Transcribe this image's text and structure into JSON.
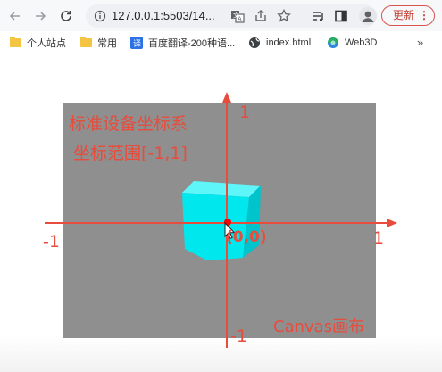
{
  "browser": {
    "url": "127.0.0.1:5503/14...",
    "update_label": "更新",
    "update_menu": "⋮",
    "bookmarks": [
      {
        "label": "个人站点",
        "icon": "folder-icon"
      },
      {
        "label": "常用",
        "icon": "folder-icon"
      },
      {
        "label": "百度翻译-200种语...",
        "icon": "baidu-translate-icon"
      },
      {
        "label": "index.html",
        "icon": "globe-icon"
      },
      {
        "label": "Web3D",
        "icon": "web3d-icon"
      }
    ],
    "more_bookmarks": "»"
  },
  "canvas": {
    "title_line1": "标准设备坐标系",
    "title_line2": "坐标范围[-1,1]",
    "caption": "Canvas画布",
    "axis": {
      "x_neg": "-1",
      "x_pos": "1",
      "y_pos": "1",
      "y_neg": "-1",
      "origin": "(0,0)"
    },
    "colors": {
      "background": "#8f8f8f",
      "axis": "#e74c3c",
      "cube_front": "#00e8ee",
      "cube_top": "#5ff6fa",
      "cube_side": "#00c4cc"
    }
  }
}
